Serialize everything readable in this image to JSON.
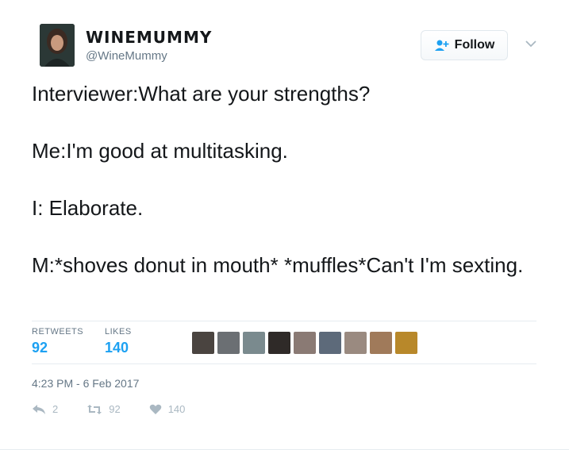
{
  "user": {
    "display_name": "WINEMUMMY",
    "screen_name": "@WineMummy"
  },
  "follow_button": {
    "label": "Follow"
  },
  "tweet": {
    "lines": [
      "Interviewer:What are your strengths?",
      "Me:I'm good at multitasking.",
      "I: Elaborate.",
      "M:*shoves donut in mouth* *muffles*Can't I'm sexting."
    ]
  },
  "stats": {
    "retweets_label": "RETWEETS",
    "retweets_count": "92",
    "likes_label": "LIKES",
    "likes_count": "140"
  },
  "timestamp": "4:23 PM - 6 Feb 2017",
  "actions": {
    "reply_count": "2",
    "retweet_count": "92",
    "like_count": "140"
  },
  "colors": {
    "link_blue": "#1da1f2",
    "muted_gray": "#657786",
    "icon_gray": "#aab8c2"
  }
}
